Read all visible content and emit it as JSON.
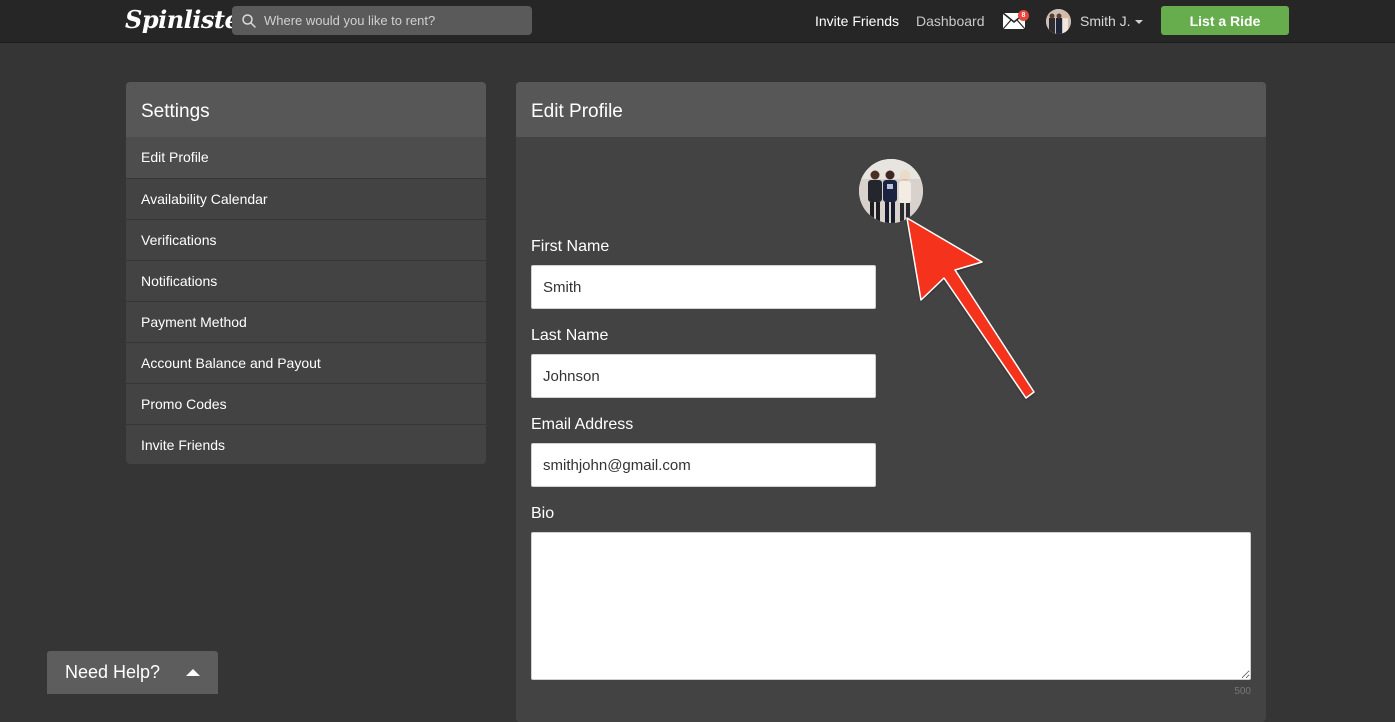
{
  "header": {
    "logo": "Spinlister",
    "search_placeholder": "Where would you like to rent?",
    "invite_friends": "Invite Friends",
    "dashboard": "Dashboard",
    "mail_count": "8",
    "user_name": "Smith J.",
    "list_ride": "List a Ride"
  },
  "sidebar": {
    "title": "Settings",
    "items": [
      {
        "label": "Edit Profile",
        "active": true
      },
      {
        "label": "Availability Calendar"
      },
      {
        "label": "Verifications"
      },
      {
        "label": "Notifications"
      },
      {
        "label": "Payment Method"
      },
      {
        "label": "Account Balance and Payout"
      },
      {
        "label": "Promo Codes"
      },
      {
        "label": "Invite Friends"
      }
    ]
  },
  "profile": {
    "title": "Edit Profile",
    "first_name_label": "First Name",
    "first_name_value": "Smith",
    "last_name_label": "Last Name",
    "last_name_value": "Johnson",
    "email_label": "Email Address",
    "email_value": "smithjohn@gmail.com",
    "bio_label": "Bio",
    "bio_value": "",
    "bio_char_count": "500"
  },
  "help": {
    "label": "Need Help?"
  },
  "colors": {
    "accent_green": "#67ad4e",
    "annotation_arrow": "#f5331f",
    "badge_red": "#e8453c"
  }
}
